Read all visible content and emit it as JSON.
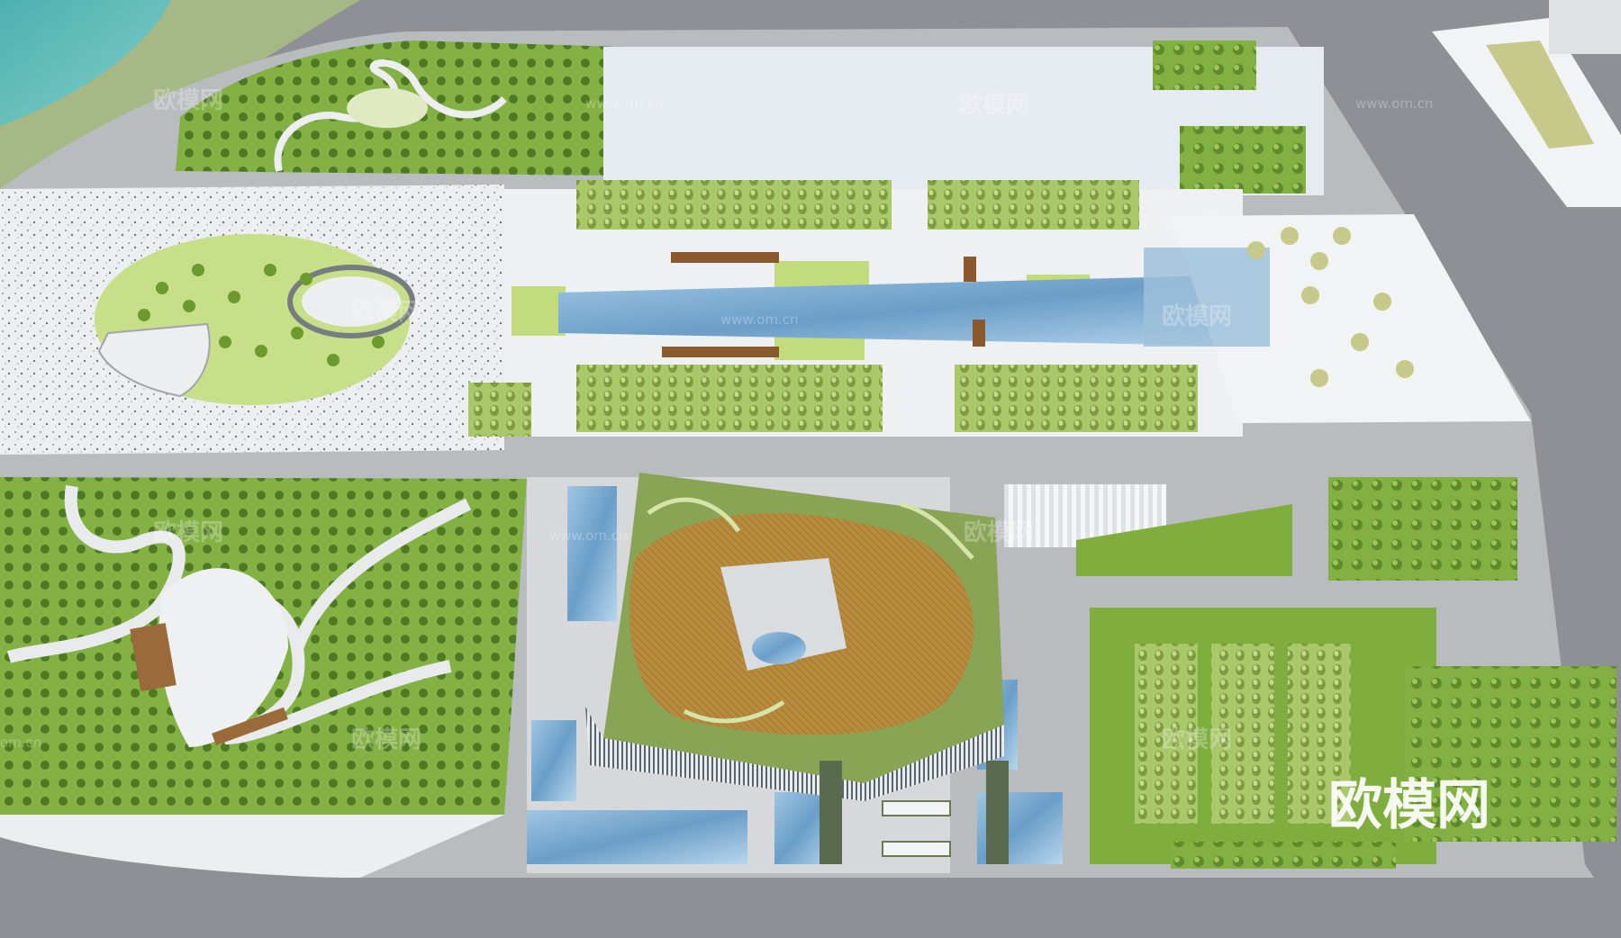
{
  "watermarks": {
    "brand": "欧模网",
    "url_left": "om.cn",
    "url_mid": "www.om.cn",
    "url_right": "www.om.cn",
    "big": "欧模网"
  },
  "colors": {
    "road": "#8e9096",
    "paving": "#c9cbcd",
    "light_paving": "#eef0f2",
    "lawn": "#7fae3f",
    "light_lawn": "#c8e08a",
    "water": "#6fa8cc",
    "river": "#5fb5b2",
    "deck": "#b58a3c"
  }
}
